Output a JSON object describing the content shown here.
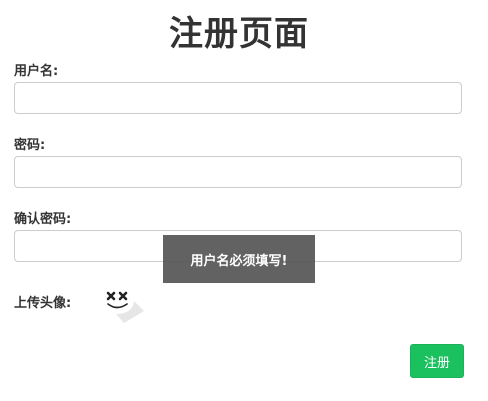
{
  "page": {
    "title": "注册页面"
  },
  "form": {
    "username_label": "用户名:",
    "username_value": "",
    "password_label": "密码:",
    "password_value": "",
    "confirm_password_label": "确认密码:",
    "confirm_password_value": "",
    "avatar_label": "上传头像:",
    "avatar_icon": "marshmello-avatar-icon",
    "submit_label": "注册"
  },
  "toast": {
    "message": "用户名必须填写!"
  },
  "colors": {
    "submit_bg": "#1cc15f",
    "toast_bg": "#555555",
    "input_border": "#cccccc",
    "text": "#333333"
  }
}
